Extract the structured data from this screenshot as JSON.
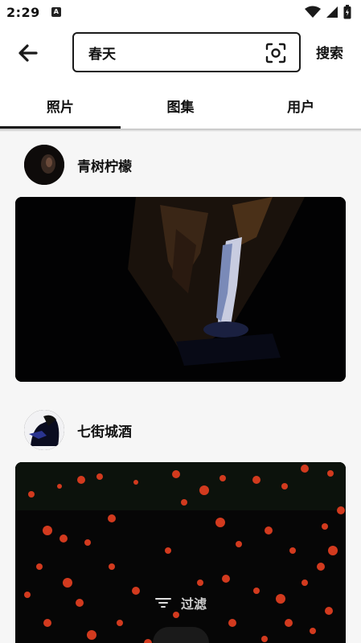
{
  "status": {
    "time": "2:29",
    "notif_letter": "A"
  },
  "header": {
    "query": "春天",
    "search_label": "搜索"
  },
  "tabs": [
    {
      "label": "照片",
      "active": true
    },
    {
      "label": "图集",
      "active": false
    },
    {
      "label": "用户",
      "active": false
    }
  ],
  "feed": {
    "posts": [
      {
        "author": "青树柠檬",
        "photo_subject": "night waterfall"
      },
      {
        "author": "七街城酒",
        "photo_subject": "red flowers"
      }
    ]
  },
  "filter": {
    "label": "过滤"
  },
  "colors": {
    "accent": "#1a1a1a",
    "background": "#f6f6f6"
  }
}
